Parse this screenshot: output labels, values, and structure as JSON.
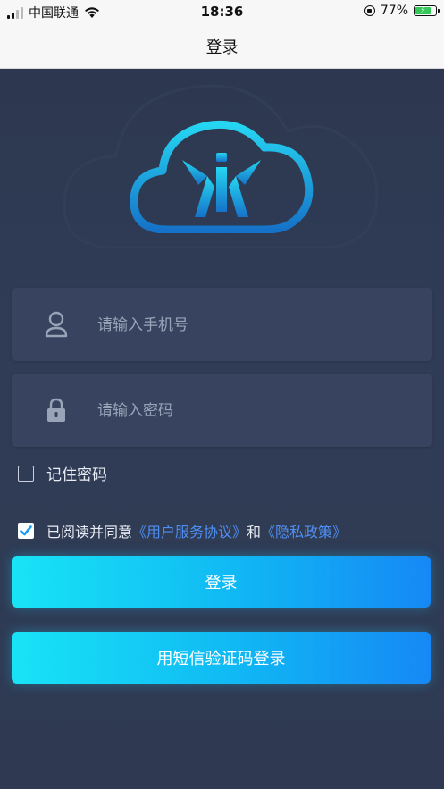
{
  "status_bar": {
    "carrier": "中国联通",
    "time": "18:36",
    "battery": "77%",
    "battery_level": 0.77
  },
  "nav": {
    "title": "登录"
  },
  "form": {
    "phone_placeholder": "请输入手机号",
    "password_placeholder": "请输入密码",
    "remember_label": "记住密码",
    "agree_prefix": "已阅读并同意",
    "user_agreement_link": "《用户服务协议》",
    "agree_and": "和",
    "privacy_link": "《隐私政策》",
    "agree_checked": true,
    "remember_checked": false
  },
  "buttons": {
    "login_label": "登录",
    "sms_login_label": "用短信验证码登录"
  },
  "colors": {
    "background": "#2f3a52",
    "accent_start": "#18e4f6",
    "accent_end": "#1688f5",
    "link": "#4e8ff3"
  },
  "icons": [
    "signal-icon",
    "wifi-icon",
    "orientation-lock-icon",
    "battery-icon",
    "cloud-logo",
    "user-icon",
    "lock-icon",
    "check-icon"
  ]
}
